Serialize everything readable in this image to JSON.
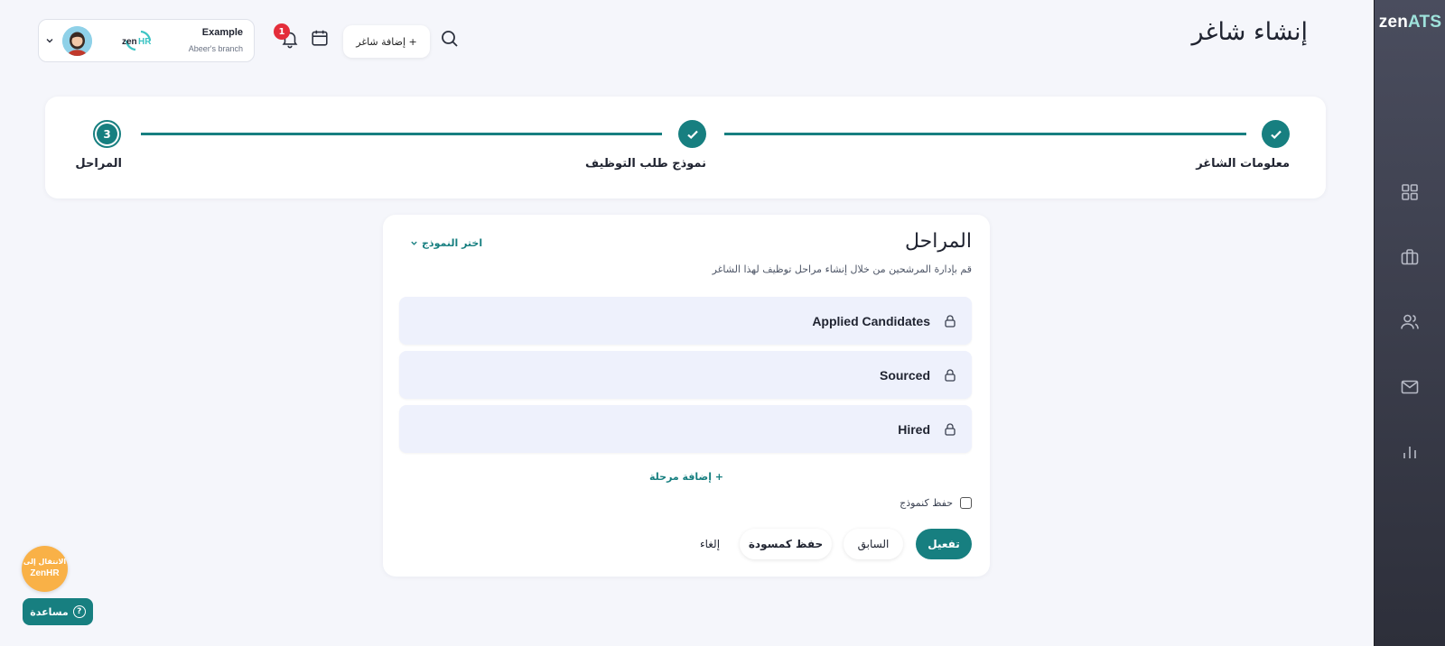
{
  "app": {
    "brand_part1": "zen",
    "brand_part2": "ATS",
    "page_title": "إنشاء شاغر",
    "accent_color": "#177f80"
  },
  "sidebar": {
    "items": [
      {
        "icon": "grid-icon"
      },
      {
        "icon": "briefcase-icon"
      },
      {
        "icon": "users-icon"
      },
      {
        "icon": "mail-icon"
      },
      {
        "icon": "bar-chart-icon"
      }
    ]
  },
  "header": {
    "add_job_label": "+ إضافة شاغر",
    "notifications_count": "1",
    "account_name": "Example",
    "account_branch": "Abeer's branch",
    "company_logo_text": "zenHR"
  },
  "stepper": {
    "steps": [
      {
        "label": "معلومات الشاغر",
        "status": "complete"
      },
      {
        "label": "نموذج طلب التوظيف",
        "status": "complete"
      },
      {
        "label": "المراحل",
        "status": "current",
        "number": "3"
      }
    ]
  },
  "stages_card": {
    "title": "المراحل",
    "subtitle": "قم بإدارة المرشحين من خلال إنشاء مراحل توظيف لهذا الشاغر",
    "template_select_label": "اختر النموذج",
    "stages": [
      {
        "name": "Applied Candidates",
        "locked": true
      },
      {
        "name": "Sourced",
        "locked": true
      },
      {
        "name": "Hired",
        "locked": true
      }
    ],
    "add_stage_label": "+ إضافة مرحلة",
    "save_as_template_label": "حفظ كنموذج",
    "save_as_template_checked": false,
    "buttons": {
      "activate": "تفعيل",
      "previous": "السابق",
      "save_draft": "حفظ كمسودة",
      "cancel": "إلغاء"
    }
  },
  "floating": {
    "switch_line1": "الانتقال إلى",
    "switch_line2": "ZenHR",
    "help_label": "مساعدة"
  }
}
